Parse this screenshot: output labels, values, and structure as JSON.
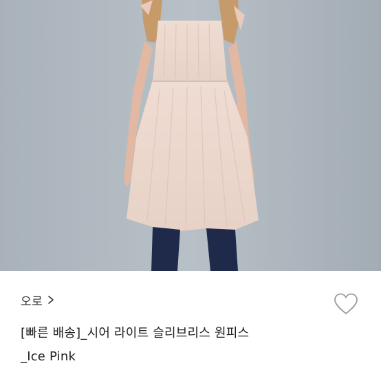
{
  "product": {
    "image_alt": "ice pink sheer sleeveless dress worn by model",
    "brand": "오로",
    "title_lines": [
      "[빠른 배송]_시어 라이트 슬리브리스 원피스",
      "_Ice Pink"
    ]
  },
  "icons": {
    "brand_chevron": "chevron-right-icon",
    "wishlist": "heart-outline-icon"
  },
  "colors": {
    "background": "#ffffff",
    "text": "#1f1f1f",
    "icon": "#9a9a9a"
  }
}
